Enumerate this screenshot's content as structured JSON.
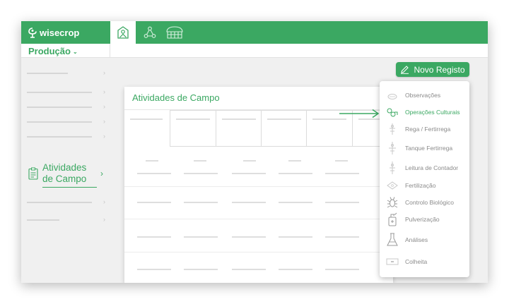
{
  "brand": {
    "name": "wisecrop"
  },
  "nav": {
    "icons": [
      "home-field-icon",
      "network-icon",
      "greenhouse-icon"
    ],
    "active": "home-field-icon"
  },
  "module": {
    "label": "Produção",
    "caret": "⌄"
  },
  "sidebar": {
    "active_item": {
      "label_line1": "Atividades",
      "label_line2": "de Campo",
      "icon": "clipboard-icon"
    },
    "chevron": "›"
  },
  "new_record_button": {
    "label": "Novo Registo",
    "icon": "pencil-icon"
  },
  "card": {
    "title": "Atividades de Campo"
  },
  "dropdown": {
    "items": [
      {
        "label": "Observações",
        "icon": "observation-icon",
        "active": false
      },
      {
        "label": "Operações Culturais",
        "icon": "cultural-operations-icon",
        "active": true
      },
      {
        "label": "Rega / Fertirrega",
        "icon": "irrigation-icon",
        "active": false
      },
      {
        "label": "Tanque Fertirrega",
        "icon": "tank-icon",
        "active": false
      },
      {
        "label": "Leitura de Contador",
        "icon": "meter-reading-icon",
        "active": false
      },
      {
        "label": "Fertilização",
        "icon": "fertilization-icon",
        "active": false
      },
      {
        "label": "Controlo Biológico",
        "icon": "bug-icon",
        "active": false
      },
      {
        "label": "Pulverização",
        "icon": "sprayer-icon",
        "active": false
      },
      {
        "label": "Análises",
        "icon": "flask-icon",
        "active": false
      },
      {
        "label": "Colheita",
        "icon": "harvest-icon",
        "active": false
      }
    ]
  },
  "colors": {
    "brand_green": "#3ba862",
    "background": "#f0f0f0",
    "muted_text": "#8a8a8a"
  }
}
